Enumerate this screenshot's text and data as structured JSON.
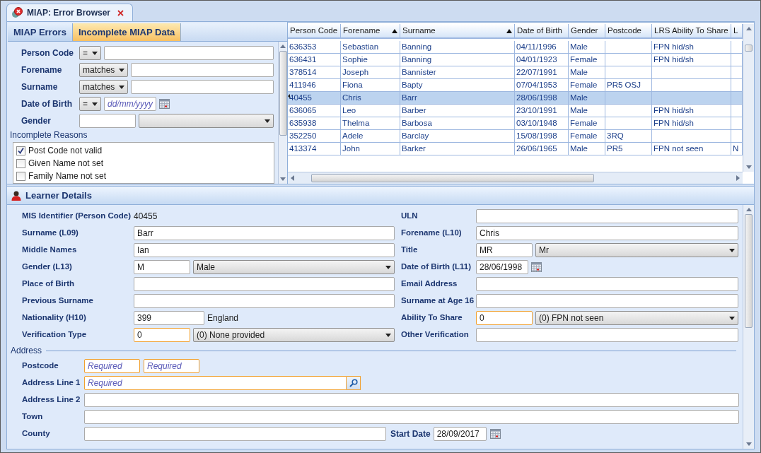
{
  "document_tab": {
    "title": "MIAP: Error Browser"
  },
  "view_tabs": [
    {
      "label": "MIAP Errors",
      "selected": false
    },
    {
      "label": "Incomplete MIAP Data",
      "selected": true
    }
  ],
  "filters": [
    {
      "label": "Person Code",
      "kind": "operator_text",
      "operator": "="
    },
    {
      "label": "Forename",
      "kind": "operator_text",
      "operator": "matches"
    },
    {
      "label": "Surname",
      "kind": "operator_text",
      "operator": "matches"
    },
    {
      "label": "Date of Birth",
      "kind": "date",
      "operator": "=",
      "placeholder": "dd/mm/yyyy"
    },
    {
      "label": "Gender",
      "kind": "code_combo"
    }
  ],
  "incomplete_reasons": {
    "title": "Incomplete Reasons",
    "items": [
      {
        "label": "Post Code not valid",
        "checked": true
      },
      {
        "label": "Given Name not set",
        "checked": false
      },
      {
        "label": "Family Name not set",
        "checked": false
      }
    ]
  },
  "grid": {
    "columns": [
      {
        "label": "Person Code",
        "sorted": false
      },
      {
        "label": "Forename",
        "sorted": true
      },
      {
        "label": "Surname",
        "sorted": true
      },
      {
        "label": "Date of Birth",
        "sorted": false
      },
      {
        "label": "Gender",
        "sorted": false
      },
      {
        "label": "Postcode",
        "sorted": false
      },
      {
        "label": "LRS Ability To Share",
        "sorted": false
      },
      {
        "label": "L",
        "sorted": false
      }
    ],
    "rows": [
      {
        "selected": false,
        "cells": [
          "636353",
          "Sebastian",
          "Banning",
          "04/11/1996",
          "Male",
          null,
          "FPN hid/sh",
          null
        ]
      },
      {
        "selected": false,
        "cells": [
          "636431",
          "Sophie",
          "Banning",
          "04/01/1923",
          "Female",
          null,
          "FPN hid/sh",
          null
        ]
      },
      {
        "selected": false,
        "cells": [
          "378514",
          "Joseph",
          "Bannister",
          "22/07/1991",
          "Male",
          null,
          null,
          null
        ]
      },
      {
        "selected": false,
        "cells": [
          "411946",
          "Fiona",
          "Bapty",
          "07/04/1953",
          "Female",
          "PR5 OSJ",
          null,
          null
        ]
      },
      {
        "selected": true,
        "cells": [
          "40455",
          "Chris",
          "Barr",
          "28/06/1998",
          "Male",
          null,
          null,
          null
        ]
      },
      {
        "selected": false,
        "cells": [
          "636065",
          "Leo",
          "Barber",
          "23/10/1991",
          "Male",
          null,
          "FPN hid/sh",
          null
        ]
      },
      {
        "selected": false,
        "cells": [
          "635938",
          "Thelma",
          "Barbosa",
          "03/10/1948",
          "Female",
          null,
          "FPN hid/sh",
          null
        ]
      },
      {
        "selected": false,
        "cells": [
          "352250",
          "Adele",
          "Barclay",
          "15/08/1998",
          "Female",
          "3RQ",
          null,
          null
        ]
      },
      {
        "selected": false,
        "cells": [
          "413374",
          "John",
          "Barker",
          "26/06/1965",
          "Male",
          "PR5",
          "FPN not seen",
          "N"
        ]
      }
    ]
  },
  "learner_details": {
    "title": "Learner Details",
    "left": [
      {
        "label": "MIS Identifier (Person Code)",
        "kind": "readonly",
        "value": "40455"
      },
      {
        "label": "Surname (L09)",
        "kind": "text",
        "value": "Barr",
        "required": false
      },
      {
        "label": "Middle Names",
        "kind": "text",
        "value": "Ian",
        "required": false
      },
      {
        "label": "Gender (L13)",
        "kind": "code_combo",
        "code": "M",
        "option": "Male",
        "required": false
      },
      {
        "label": "Place of Birth",
        "kind": "text",
        "required": false
      },
      {
        "label": "Previous Surname",
        "kind": "text",
        "required": false
      },
      {
        "label": "Nationality (H10)",
        "kind": "code_text",
        "code": "399",
        "text": "England",
        "required": false
      },
      {
        "label": "Verification Type",
        "kind": "code_combo",
        "code": "0",
        "option": "(0) None provided",
        "required": true
      }
    ],
    "right": [
      {
        "label": "ULN",
        "kind": "text",
        "required": false
      },
      {
        "label": "Forename (L10)",
        "kind": "text",
        "value": "Chris",
        "required": false
      },
      {
        "label": "Title",
        "kind": "code_combo",
        "code": "MR",
        "option": "Mr",
        "required": false
      },
      {
        "label": "Date of Birth (L11)",
        "kind": "date",
        "value": "28/06/1998",
        "required": false
      },
      {
        "label": "Email Address",
        "kind": "text",
        "required": false
      },
      {
        "label": "Surname at Age 16",
        "kind": "text",
        "required": false
      },
      {
        "label": "Ability To Share",
        "kind": "code_combo",
        "code": "0",
        "option": "(0) FPN not seen",
        "required": true
      },
      {
        "label": "Other Verification",
        "kind": "text",
        "required": false
      }
    ]
  },
  "address": {
    "legend": "Address",
    "fields": [
      {
        "label": "Postcode",
        "kind": "pair",
        "inputs": [
          {
            "placeholder": "Required",
            "required": true
          },
          {
            "placeholder": "Required",
            "required": true
          }
        ]
      },
      {
        "label": "Address Line 1",
        "kind": "lookup",
        "placeholder": "Required",
        "required": true
      },
      {
        "label": "Address Line 2",
        "kind": "text",
        "required": false
      },
      {
        "label": "Town",
        "kind": "text",
        "required": false
      },
      {
        "label": "County",
        "kind": "text_with_date",
        "required": false,
        "date_label": "Start Date",
        "date_value": "28/09/2017"
      }
    ]
  }
}
